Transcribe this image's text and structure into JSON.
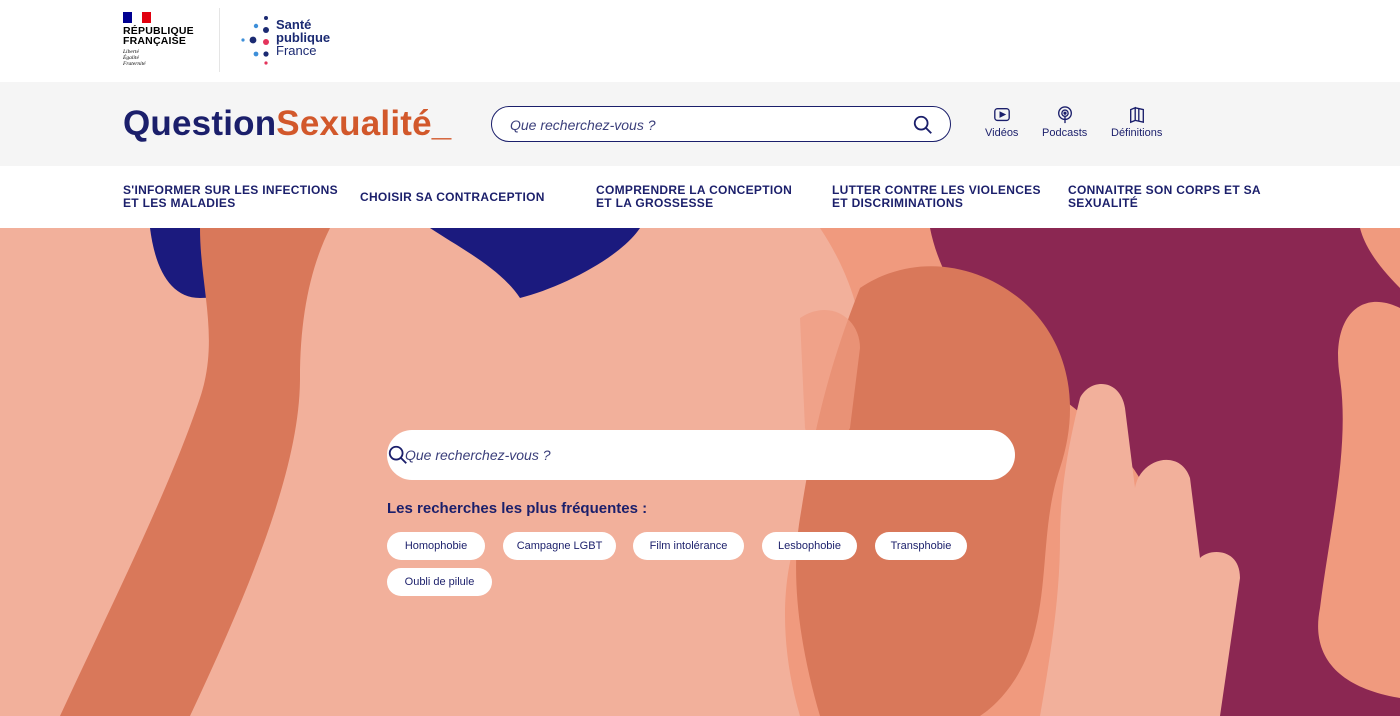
{
  "topbar": {
    "republique": {
      "line1": "RÉPUBLIQUE",
      "line2": "FRANÇAISE",
      "motto1": "Liberté",
      "motto2": "Égalité",
      "motto3": "Fraternité"
    },
    "spf": {
      "word1": "Santé",
      "word2": "publique",
      "word3": "France"
    }
  },
  "header": {
    "brand_part1": "Question",
    "brand_part2": "Sexualité_",
    "search_placeholder": "Que recherchez-vous ?",
    "quick_links": [
      {
        "label": "Vidéos",
        "icon": "video-icon"
      },
      {
        "label": "Podcasts",
        "icon": "podcast-icon"
      },
      {
        "label": "Définitions",
        "icon": "book-icon"
      }
    ]
  },
  "nav": {
    "items": [
      {
        "label": "S'INFORMER SUR LES INFECTIONS ET LES MALADIES"
      },
      {
        "label": "CHOISIR SA CONTRACEPTION"
      },
      {
        "label": "COMPRENDRE LA CONCEPTION ET LA GROSSESSE"
      },
      {
        "label": "LUTTER CONTRE LES VIOLENCES ET DISCRIMINATIONS"
      },
      {
        "label": "CONNAITRE SON CORPS ET SA SEXUALITÉ"
      }
    ]
  },
  "hero": {
    "search_placeholder": "Que recherchez-vous ?",
    "frequent_title": "Les recherches les plus fréquentes :",
    "chips": [
      "Homophobie",
      "Campagne LGBT",
      "Film intolérance",
      "Lesbophobie",
      "Transphobie",
      "Oubli de pilule"
    ]
  },
  "colors": {
    "navy": "#1b1f6b",
    "orange": "#d2582b",
    "hero_bg": "#f09a7e",
    "plum": "#8b2752"
  }
}
